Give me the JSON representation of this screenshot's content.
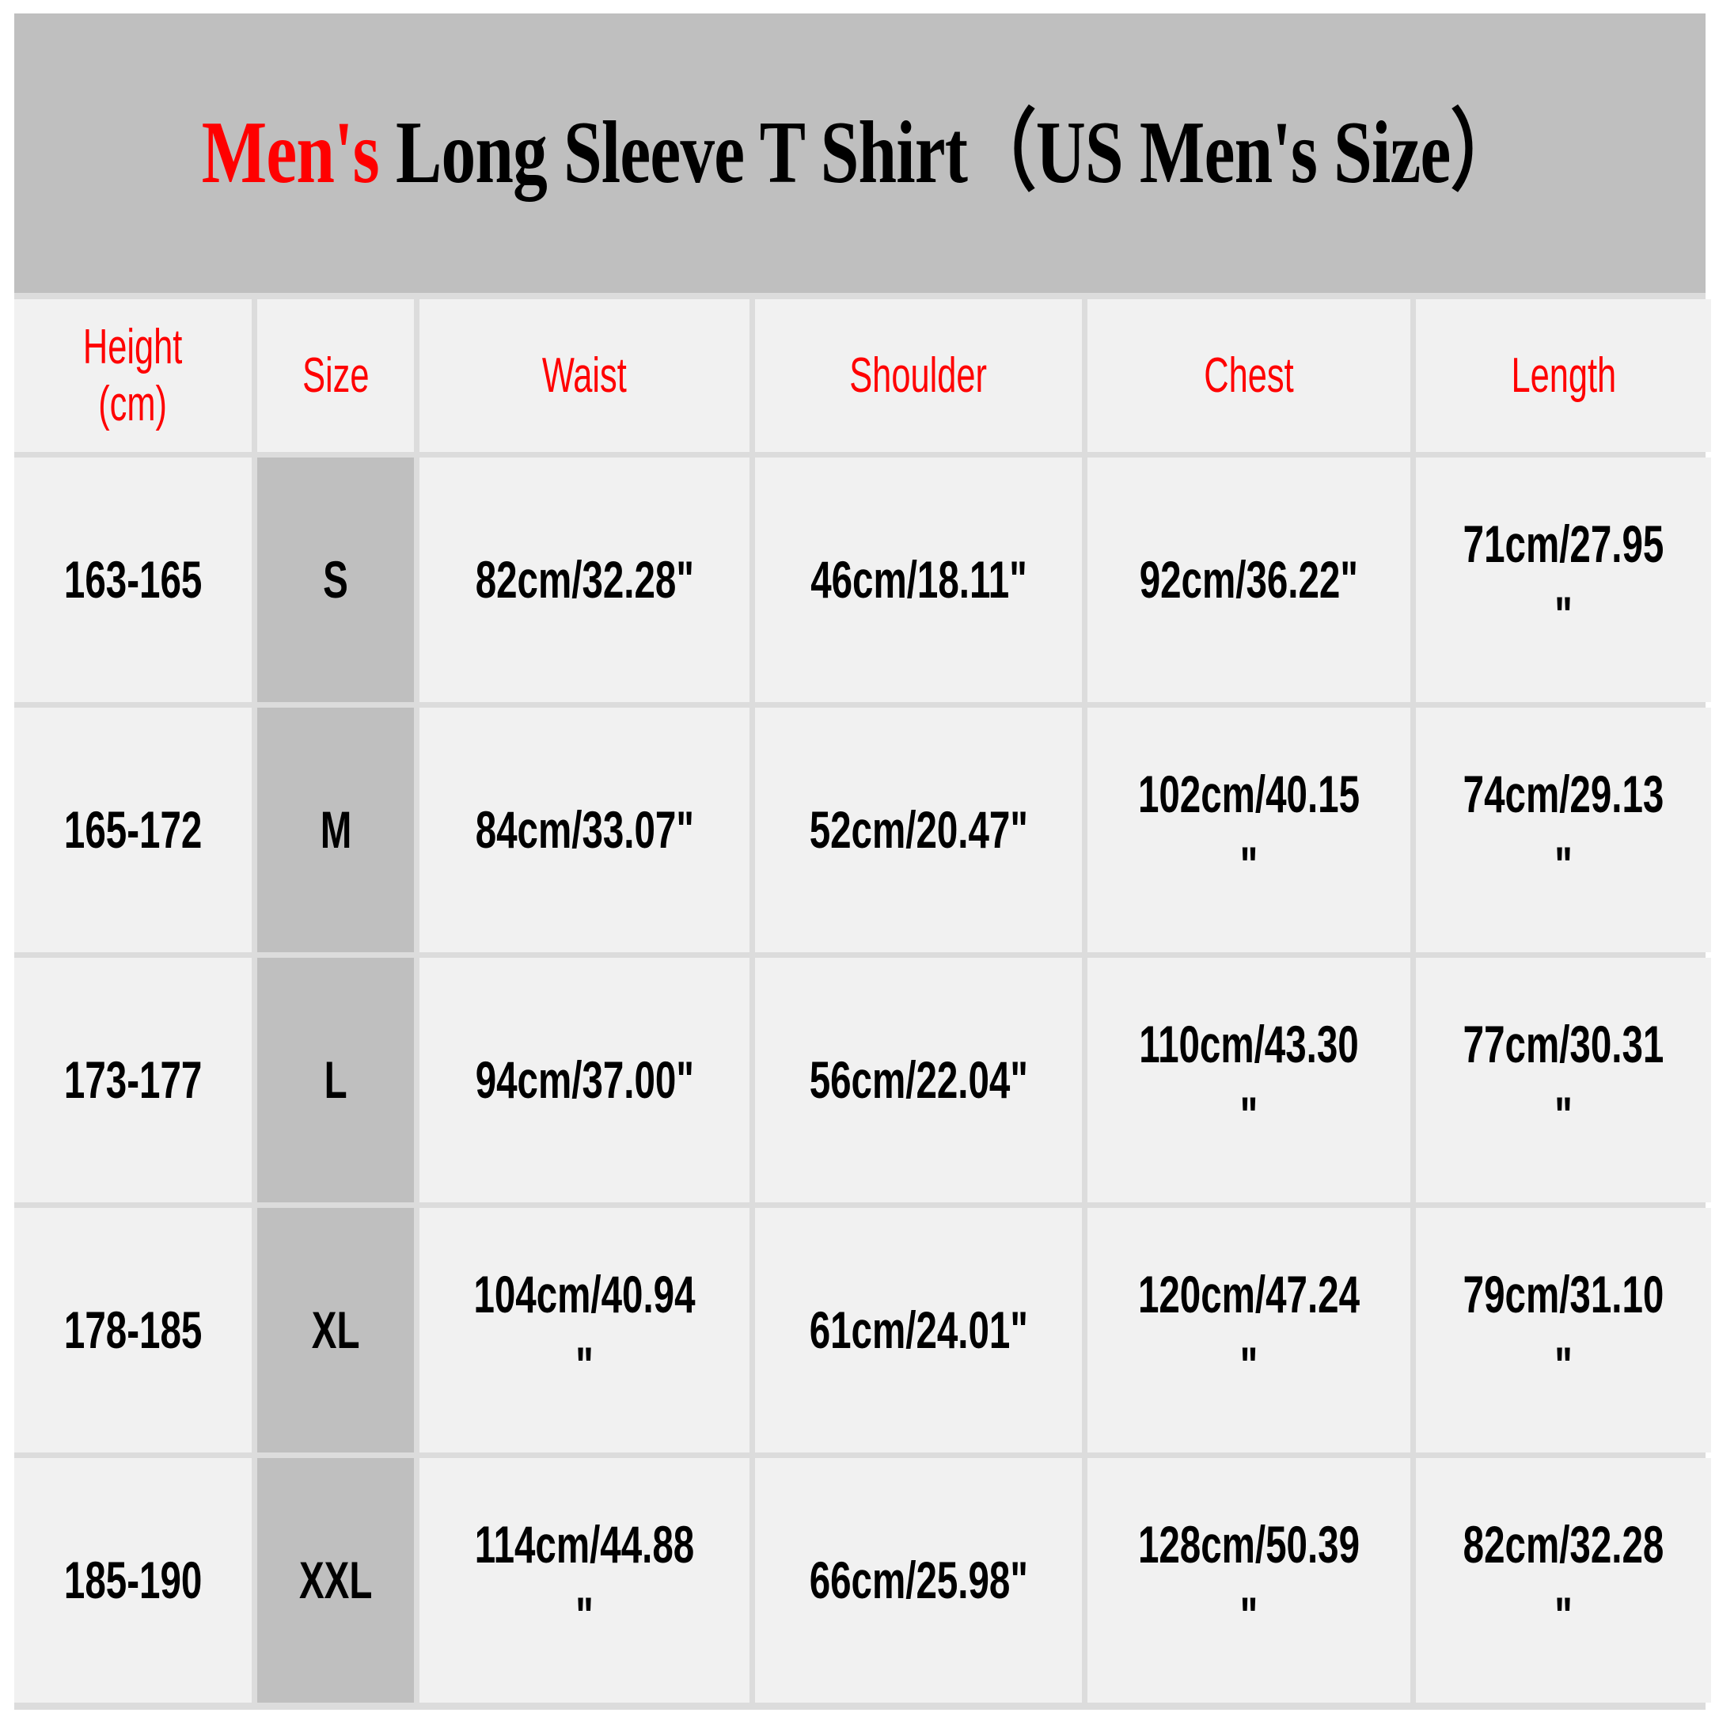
{
  "title": {
    "accent": "Men's",
    "rest": " Long Sleeve T Shirt（US  Men's  Size）",
    "accent_color": "#ff0000",
    "band_color": "#bfbfbf"
  },
  "table": {
    "header_color": "#ff0000",
    "size_cell_color": "#bfbfbf",
    "cell_color": "#f1f1f1",
    "grid_color": "#dcdcdc",
    "columns": [
      {
        "key": "height",
        "label": "Height\n(cm)"
      },
      {
        "key": "size",
        "label": "Size"
      },
      {
        "key": "waist",
        "label": "Waist"
      },
      {
        "key": "shoulder",
        "label": "Shoulder"
      },
      {
        "key": "chest",
        "label": "Chest"
      },
      {
        "key": "length",
        "label": "Length"
      }
    ],
    "rows": [
      {
        "height": "163-165",
        "size": "S",
        "waist": "82cm/32.28\"",
        "shoulder": "46cm/18.11\"",
        "chest": "92cm/36.22\"",
        "length": "71cm/27.95\""
      },
      {
        "height": "165-172",
        "size": "M",
        "waist": "84cm/33.07\"",
        "shoulder": "52cm/20.47\"",
        "chest": "102cm/40.15\"",
        "length": "74cm/29.13\""
      },
      {
        "height": "173-177",
        "size": "L",
        "waist": "94cm/37.00\"",
        "shoulder": "56cm/22.04\"",
        "chest": "110cm/43.30\"",
        "length": "77cm/30.31\""
      },
      {
        "height": "178-185",
        "size": "XL",
        "waist": "104cm/40.94\"",
        "shoulder": "61cm/24.01\"",
        "chest": "120cm/47.24\"",
        "length": "79cm/31.10\""
      },
      {
        "height": "185-190",
        "size": "XXL",
        "waist": "114cm/44.88\"",
        "shoulder": "66cm/25.98\"",
        "chest": "128cm/50.39\"",
        "length": "82cm/32.28\""
      }
    ]
  }
}
